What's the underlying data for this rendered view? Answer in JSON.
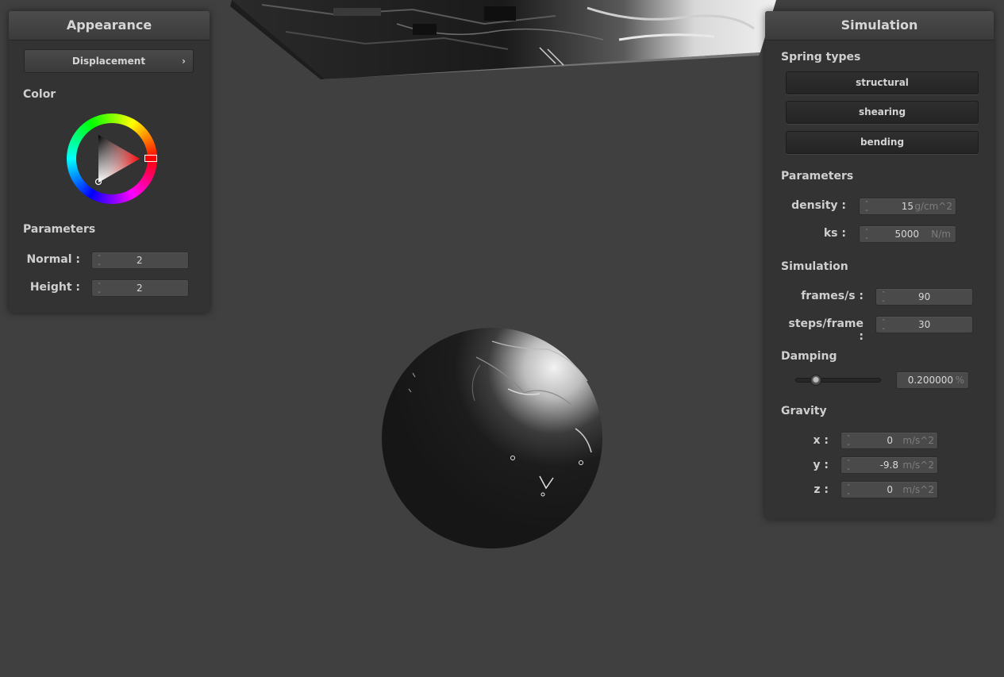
{
  "appearance": {
    "title": "Appearance",
    "shader_select": "Displacement",
    "color_title": "Color",
    "color_selected": "#ff0000",
    "params_title": "Parameters",
    "normal": {
      "label": "Normal :",
      "value": "2"
    },
    "height": {
      "label": "Height :",
      "value": "2"
    }
  },
  "simulation": {
    "title": "Simulation",
    "spring_types_title": "Spring types",
    "spring_buttons": [
      "structural",
      "shearing",
      "bending"
    ],
    "params_title": "Parameters",
    "density": {
      "label": "density :",
      "value": "15",
      "unit": "g/cm^2"
    },
    "ks": {
      "label": "ks :",
      "value": "5000",
      "unit": "N/m"
    },
    "sim_title": "Simulation",
    "fps": {
      "label": "frames/s :",
      "value": "90"
    },
    "steps": {
      "label": "steps/frame :",
      "value": "30"
    },
    "damping_title": "Damping",
    "damping": {
      "value": "0.200000",
      "unit": "%",
      "slider_fraction": 0.2
    },
    "gravity_title": "Gravity",
    "gravity": {
      "x": {
        "label": "x :",
        "value": "0",
        "unit": "m/s^2"
      },
      "y": {
        "label": "y :",
        "value": "-9.8",
        "unit": "m/s^2"
      },
      "z": {
        "label": "z :",
        "value": "0",
        "unit": "m/s^2"
      }
    }
  },
  "colors": {
    "background": "#404040",
    "panel": "#333333",
    "accent": "#ff0000"
  },
  "icons": {
    "chevron": "chevron-right-icon",
    "spinner": "spinner-arrows-icon",
    "slider_knob": "slider-knob-icon"
  }
}
